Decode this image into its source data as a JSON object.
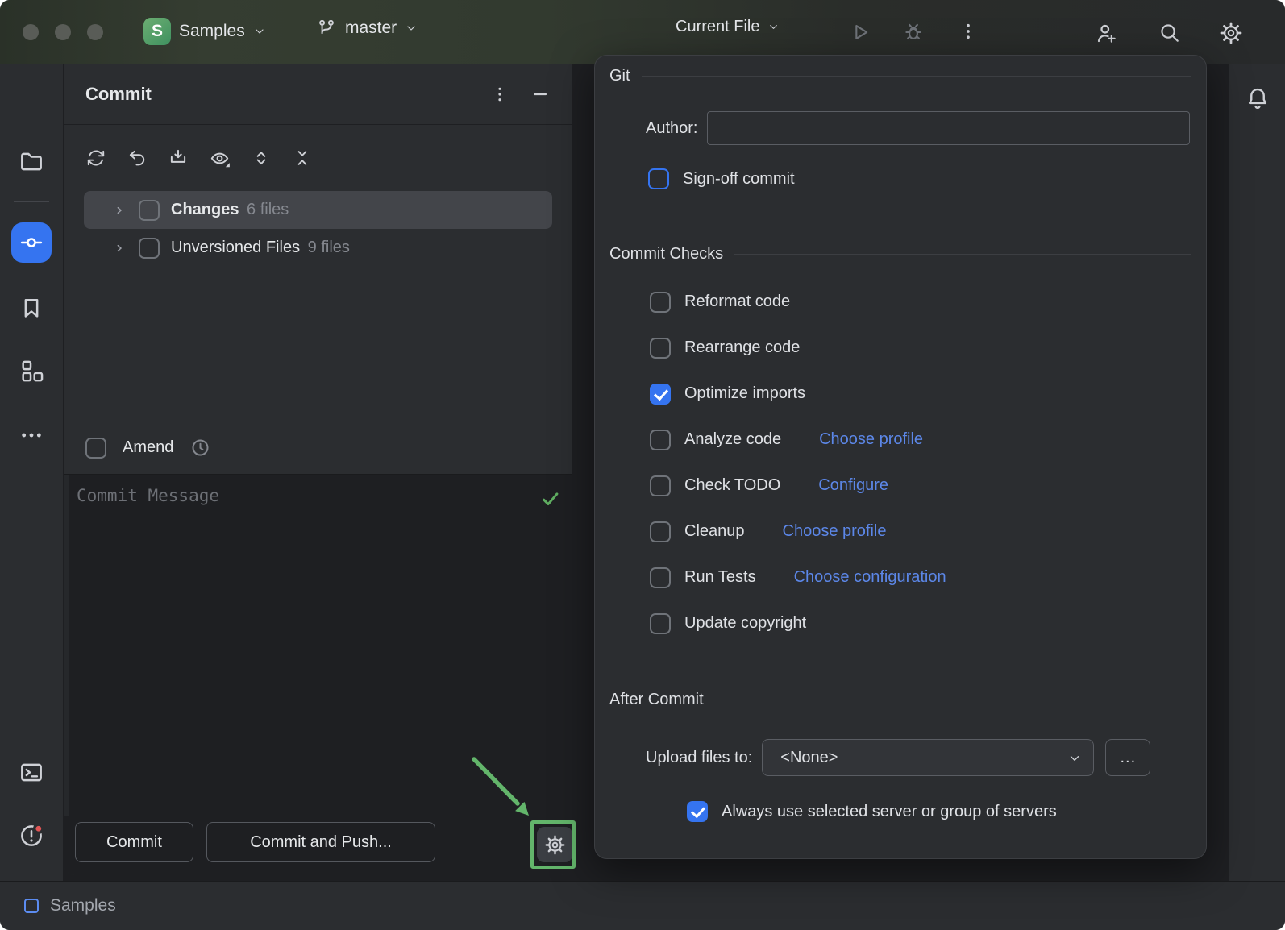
{
  "colors": {
    "accent_blue": "#3574f0",
    "link_blue": "#5c87e8",
    "annotation_green": "#63b56b",
    "success_green": "#5fad61",
    "panel_bg": "#2b2d30",
    "editor_bg": "#1e1f22"
  },
  "titlebar": {
    "project_initial": "S",
    "project_name": "Samples",
    "branch": "master",
    "run_config": "Current File",
    "icons": [
      "project-chevron-icon",
      "branch-icon",
      "run-chevron-icon",
      "run-icon",
      "debug-icon",
      "more-kebab-icon",
      "add-user-icon",
      "search-icon",
      "settings-gear-icon"
    ]
  },
  "sidebar": {
    "top_icons": [
      "folder-icon",
      "commit-icon",
      "bookmark-icon",
      "structure-icon",
      "more-icon"
    ],
    "bottom_icons": [
      "terminal-icon",
      "problems-icon",
      "git-branch-icon"
    ],
    "active_tool": "commit"
  },
  "commit_panel": {
    "title": "Commit",
    "toolbar_icons": [
      "refresh-icon",
      "rollback-icon",
      "shelve-icon",
      "view-options-icon",
      "expand-all-icon",
      "collapse-all-icon"
    ],
    "tree": {
      "changes_label": "Changes",
      "changes_count": "6 files",
      "unversioned_label": "Unversioned Files",
      "unversioned_count": "9 files"
    },
    "amend_label": "Amend",
    "message_placeholder": "Commit Message",
    "commit_button": "Commit",
    "commit_push_button": "Commit and Push...",
    "gear_highlighted": true
  },
  "popup": {
    "git_section": {
      "title": "Git",
      "author_label": "Author:",
      "author_value": "",
      "signoff_label": "Sign-off commit",
      "signoff_checked": false
    },
    "commit_checks": {
      "title": "Commit Checks",
      "items": [
        {
          "label": "Reformat code",
          "checked": false
        },
        {
          "label": "Rearrange code",
          "checked": false
        },
        {
          "label": "Optimize imports",
          "checked": true
        },
        {
          "label": "Analyze code",
          "checked": false,
          "link": "Choose profile"
        },
        {
          "label": "Check TODO",
          "checked": false,
          "link": "Configure"
        },
        {
          "label": "Cleanup",
          "checked": false,
          "link": "Choose profile"
        },
        {
          "label": "Run Tests",
          "checked": false,
          "link": "Choose configuration"
        },
        {
          "label": "Update copyright",
          "checked": false
        }
      ]
    },
    "after_commit": {
      "title": "After Commit",
      "upload_label": "Upload files to:",
      "upload_value": "<None>",
      "more_button": "...",
      "always_label": "Always use selected server or group of servers",
      "always_checked": true
    }
  },
  "statusbar": {
    "project": "Samples"
  }
}
